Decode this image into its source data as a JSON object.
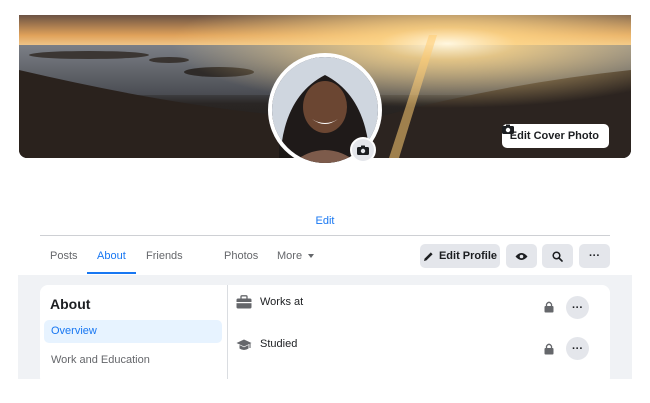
{
  "cover": {
    "edit_cover_label": "Edit Cover Photo"
  },
  "profile": {
    "edit_link": "Edit"
  },
  "tabs": [
    {
      "label": "Posts"
    },
    {
      "label": "About"
    },
    {
      "label": "Friends"
    },
    {
      "label": "Photos"
    },
    {
      "label": "More"
    }
  ],
  "actions": {
    "edit_profile_label": "Edit Profile",
    "more_label": "···"
  },
  "about": {
    "title": "About",
    "nav": [
      {
        "label": "Overview"
      },
      {
        "label": "Work and Education"
      }
    ],
    "rows": [
      {
        "label": "Works at",
        "icon": "briefcase-icon"
      },
      {
        "label": "Studied",
        "icon": "graduation-cap-icon"
      }
    ],
    "row_menu_label": "···"
  },
  "colors": {
    "accent": "#1877f2",
    "button_gray": "#e4e6eb",
    "page_gray": "#f0f2f5"
  }
}
